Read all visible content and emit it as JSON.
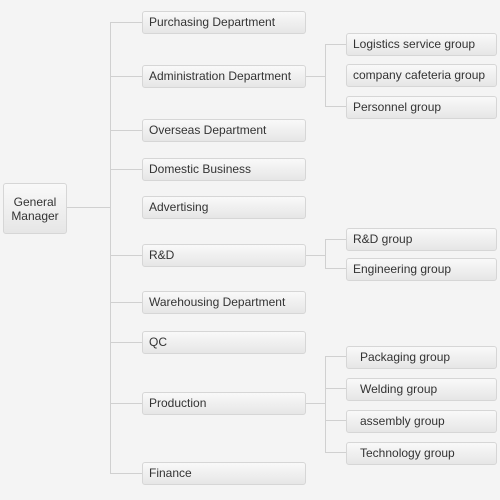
{
  "root": {
    "label_line1": "General",
    "label_line2": "Manager"
  },
  "departments": [
    {
      "label": "Purchasing Department"
    },
    {
      "label": "Administration Department",
      "groups": [
        "Logistics service group",
        "company cafeteria group",
        "Personnel group"
      ]
    },
    {
      "label": "Overseas  Department"
    },
    {
      "label": "Domestic  Business"
    },
    {
      "label": "Advertising"
    },
    {
      "label": "R&D",
      "groups": [
        "R&D group",
        "Engineering group"
      ]
    },
    {
      "label": "Warehousing  Department"
    },
    {
      "label": "QC"
    },
    {
      "label": "Production",
      "groups": [
        "Packaging group",
        "Welding group",
        "assembly group",
        "Technology group"
      ]
    },
    {
      "label": "Finance"
    }
  ]
}
